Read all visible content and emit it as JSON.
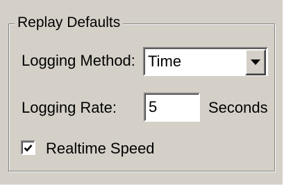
{
  "group": {
    "title": "Replay Defaults"
  },
  "logging_method": {
    "label": "Logging Method:",
    "selected": "Time",
    "icon": "chevron-down-icon"
  },
  "logging_rate": {
    "label": "Logging Rate:",
    "value": "5",
    "unit": "Seconds"
  },
  "realtime_speed": {
    "label": "Realtime Speed",
    "checked": true,
    "icon": "checkmark-icon"
  }
}
